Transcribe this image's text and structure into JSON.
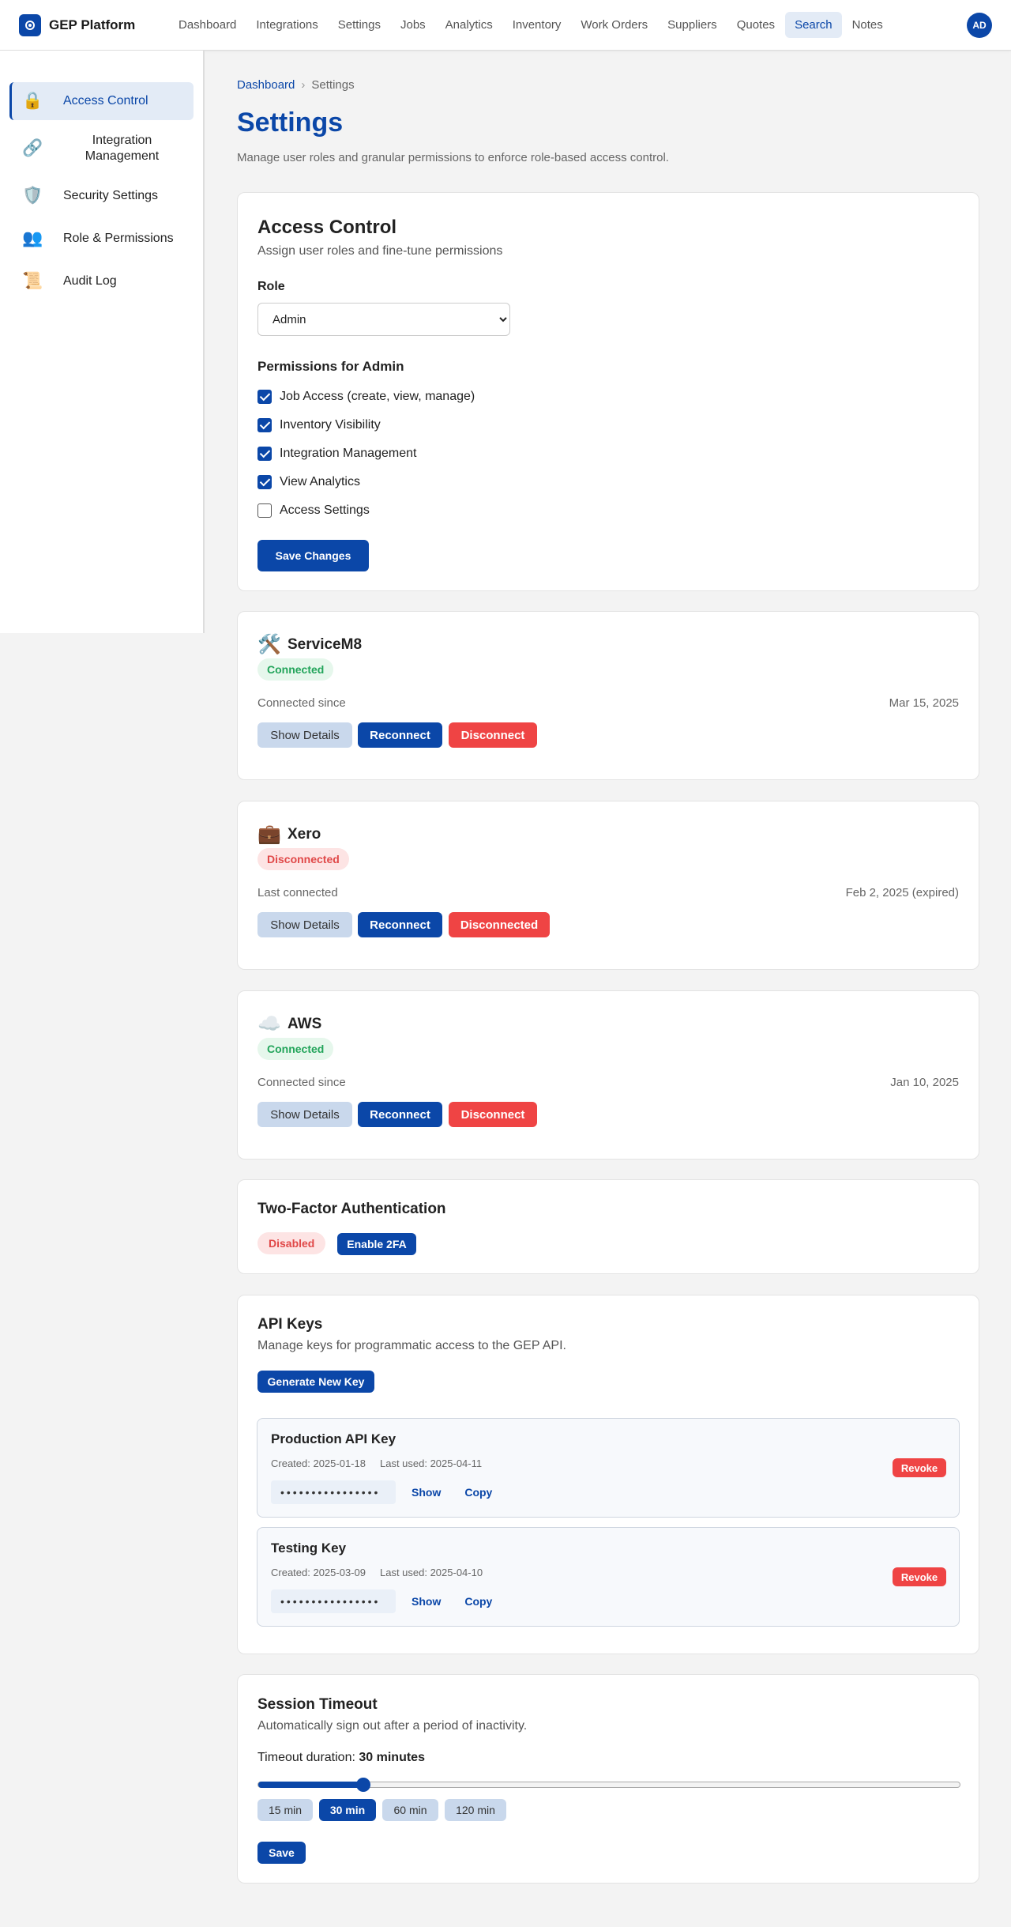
{
  "brand": {
    "name": "GEP Platform"
  },
  "nav": {
    "items": [
      {
        "label": "Dashboard"
      },
      {
        "label": "Integrations"
      },
      {
        "label": "Settings"
      },
      {
        "label": "Jobs"
      },
      {
        "label": "Analytics"
      },
      {
        "label": "Inventory"
      },
      {
        "label": "Work Orders"
      },
      {
        "label": "Suppliers"
      },
      {
        "label": "Quotes"
      },
      {
        "label": "Search"
      },
      {
        "label": "Notes"
      }
    ],
    "active": "Search",
    "avatar_initials": "AD"
  },
  "sidebar": {
    "items": [
      {
        "label": "Access Control",
        "icon": "lock-icon",
        "glyph": "🔒"
      },
      {
        "label": "Integration Management",
        "icon": "link-icon",
        "glyph": "🔗"
      },
      {
        "label": "Security Settings",
        "icon": "shield-icon",
        "glyph": "🛡️"
      },
      {
        "label": "Role & Permissions",
        "icon": "users-icon",
        "glyph": "👥"
      },
      {
        "label": "Audit Log",
        "icon": "scroll-icon",
        "glyph": "📜"
      }
    ],
    "active": "Access Control"
  },
  "header": {
    "breadcrumb": [
      "Dashboard",
      "Settings"
    ],
    "breadcrumb_sep": "›",
    "title": "Settings",
    "subtitle": "Manage user roles and granular permissions to enforce role-based access control."
  },
  "access_control": {
    "title": "Access Control",
    "subtitle": "Assign user roles and fine-tune permissions",
    "role_label": "Role",
    "role_value": "Admin",
    "permissions_title": "Permissions for Admin",
    "permissions": [
      {
        "label": "Job Access (create, view, manage)",
        "checked": true
      },
      {
        "label": "Inventory Visibility",
        "checked": true
      },
      {
        "label": "Integration Management",
        "checked": true
      },
      {
        "label": "View Analytics",
        "checked": true
      },
      {
        "label": "Access Settings",
        "checked": false
      }
    ],
    "save_label": "Save Changes"
  },
  "integrations": [
    {
      "name": "ServiceM8",
      "icon": "tools-icon",
      "glyph": "🛠️",
      "status": "Connected",
      "status_color": "#22a45a",
      "since_label": "Connected since",
      "since_value": "Mar 15, 2025",
      "details_label": "Show Details",
      "reconnect_label": "Reconnect",
      "disconnect_label": "Disconnect"
    },
    {
      "name": "Xero",
      "icon": "briefcase-icon",
      "glyph": "💼",
      "status": "Disconnected",
      "status_color": "#e04848",
      "since_label": "Last connected",
      "since_value": "Feb 2, 2025 (expired)",
      "details_label": "Show Details",
      "reconnect_label": "Reconnect",
      "disconnect_label": "Disconnected"
    },
    {
      "name": "AWS",
      "icon": "cloud-icon",
      "glyph": "☁️",
      "status": "Connected",
      "status_color": "#22a45a",
      "since_label": "Connected since",
      "since_value": "Jan 10, 2025",
      "details_label": "Show Details",
      "reconnect_label": "Reconnect",
      "disconnect_label": "Disconnect"
    }
  ],
  "two_factor": {
    "title": "Two-Factor Authentication",
    "status": "Disabled",
    "enable_label": "Enable 2FA"
  },
  "api_keys": {
    "title": "API Keys",
    "subtitle": "Manage keys for programmatic access to the GEP API.",
    "generate_label": "Generate New Key",
    "keys": [
      {
        "name": "Production API Key",
        "created": "Created: 2025-01-18",
        "last_used": "Last used: 2025-04-11",
        "masked": "••••••••••••••••",
        "show_label": "Show",
        "copy_label": "Copy",
        "revoke_label": "Revoke"
      },
      {
        "name": "Testing Key",
        "created": "Created: 2025-03-09",
        "last_used": "Last used: 2025-04-10",
        "masked": "••••••••••••••••",
        "show_label": "Show",
        "copy_label": "Copy",
        "revoke_label": "Revoke"
      }
    ]
  },
  "session": {
    "title": "Session Timeout",
    "subtitle": "Automatically sign out after a period of inactivity.",
    "duration_label": "Timeout duration:",
    "duration_value": "30 minutes",
    "slider_fraction": 0.15,
    "options": [
      "15 min",
      "30 min",
      "60 min",
      "120 min"
    ],
    "active_option": "30 min",
    "save_label": "Save"
  },
  "colors": {
    "primary": "#0b47a8",
    "danger": "#ef4444",
    "success": "#22a45a"
  }
}
